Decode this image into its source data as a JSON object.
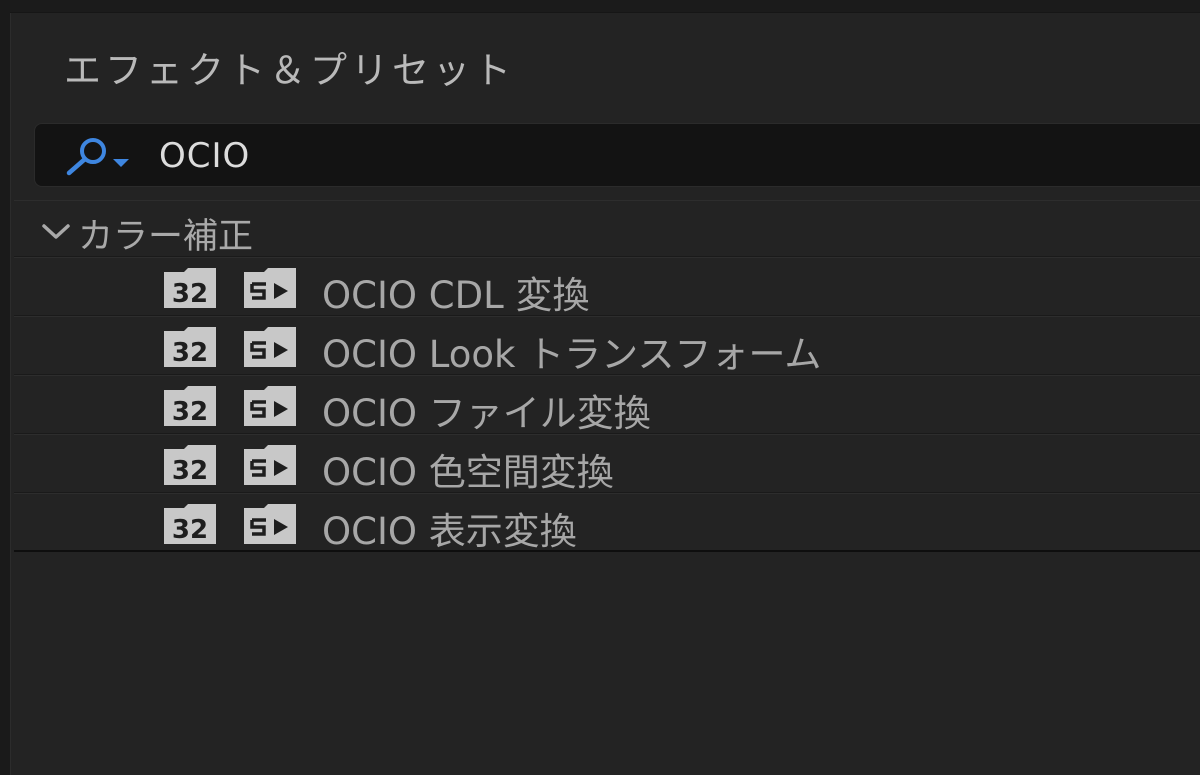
{
  "panel": {
    "title": "エフェクト＆プリセット"
  },
  "search": {
    "value": "OCIO",
    "icon": "search-icon"
  },
  "category": {
    "label": "カラー補正",
    "icon": "chevron-down-icon"
  },
  "effects": [
    {
      "label": "OCIO CDL 変換",
      "bpc_badge": "32"
    },
    {
      "label": "OCIO Look トランスフォーム",
      "bpc_badge": "32"
    },
    {
      "label": "OCIO ファイル変換",
      "bpc_badge": "32"
    },
    {
      "label": "OCIO 色空間変換",
      "bpc_badge": "32"
    },
    {
      "label": "OCIO 表示変換",
      "bpc_badge": "32"
    }
  ],
  "colors": {
    "background": "#232323",
    "search_bg": "#131313",
    "accent": "#3e86e0",
    "text": "#a7a7a7",
    "badge": "#c8c8c8"
  }
}
